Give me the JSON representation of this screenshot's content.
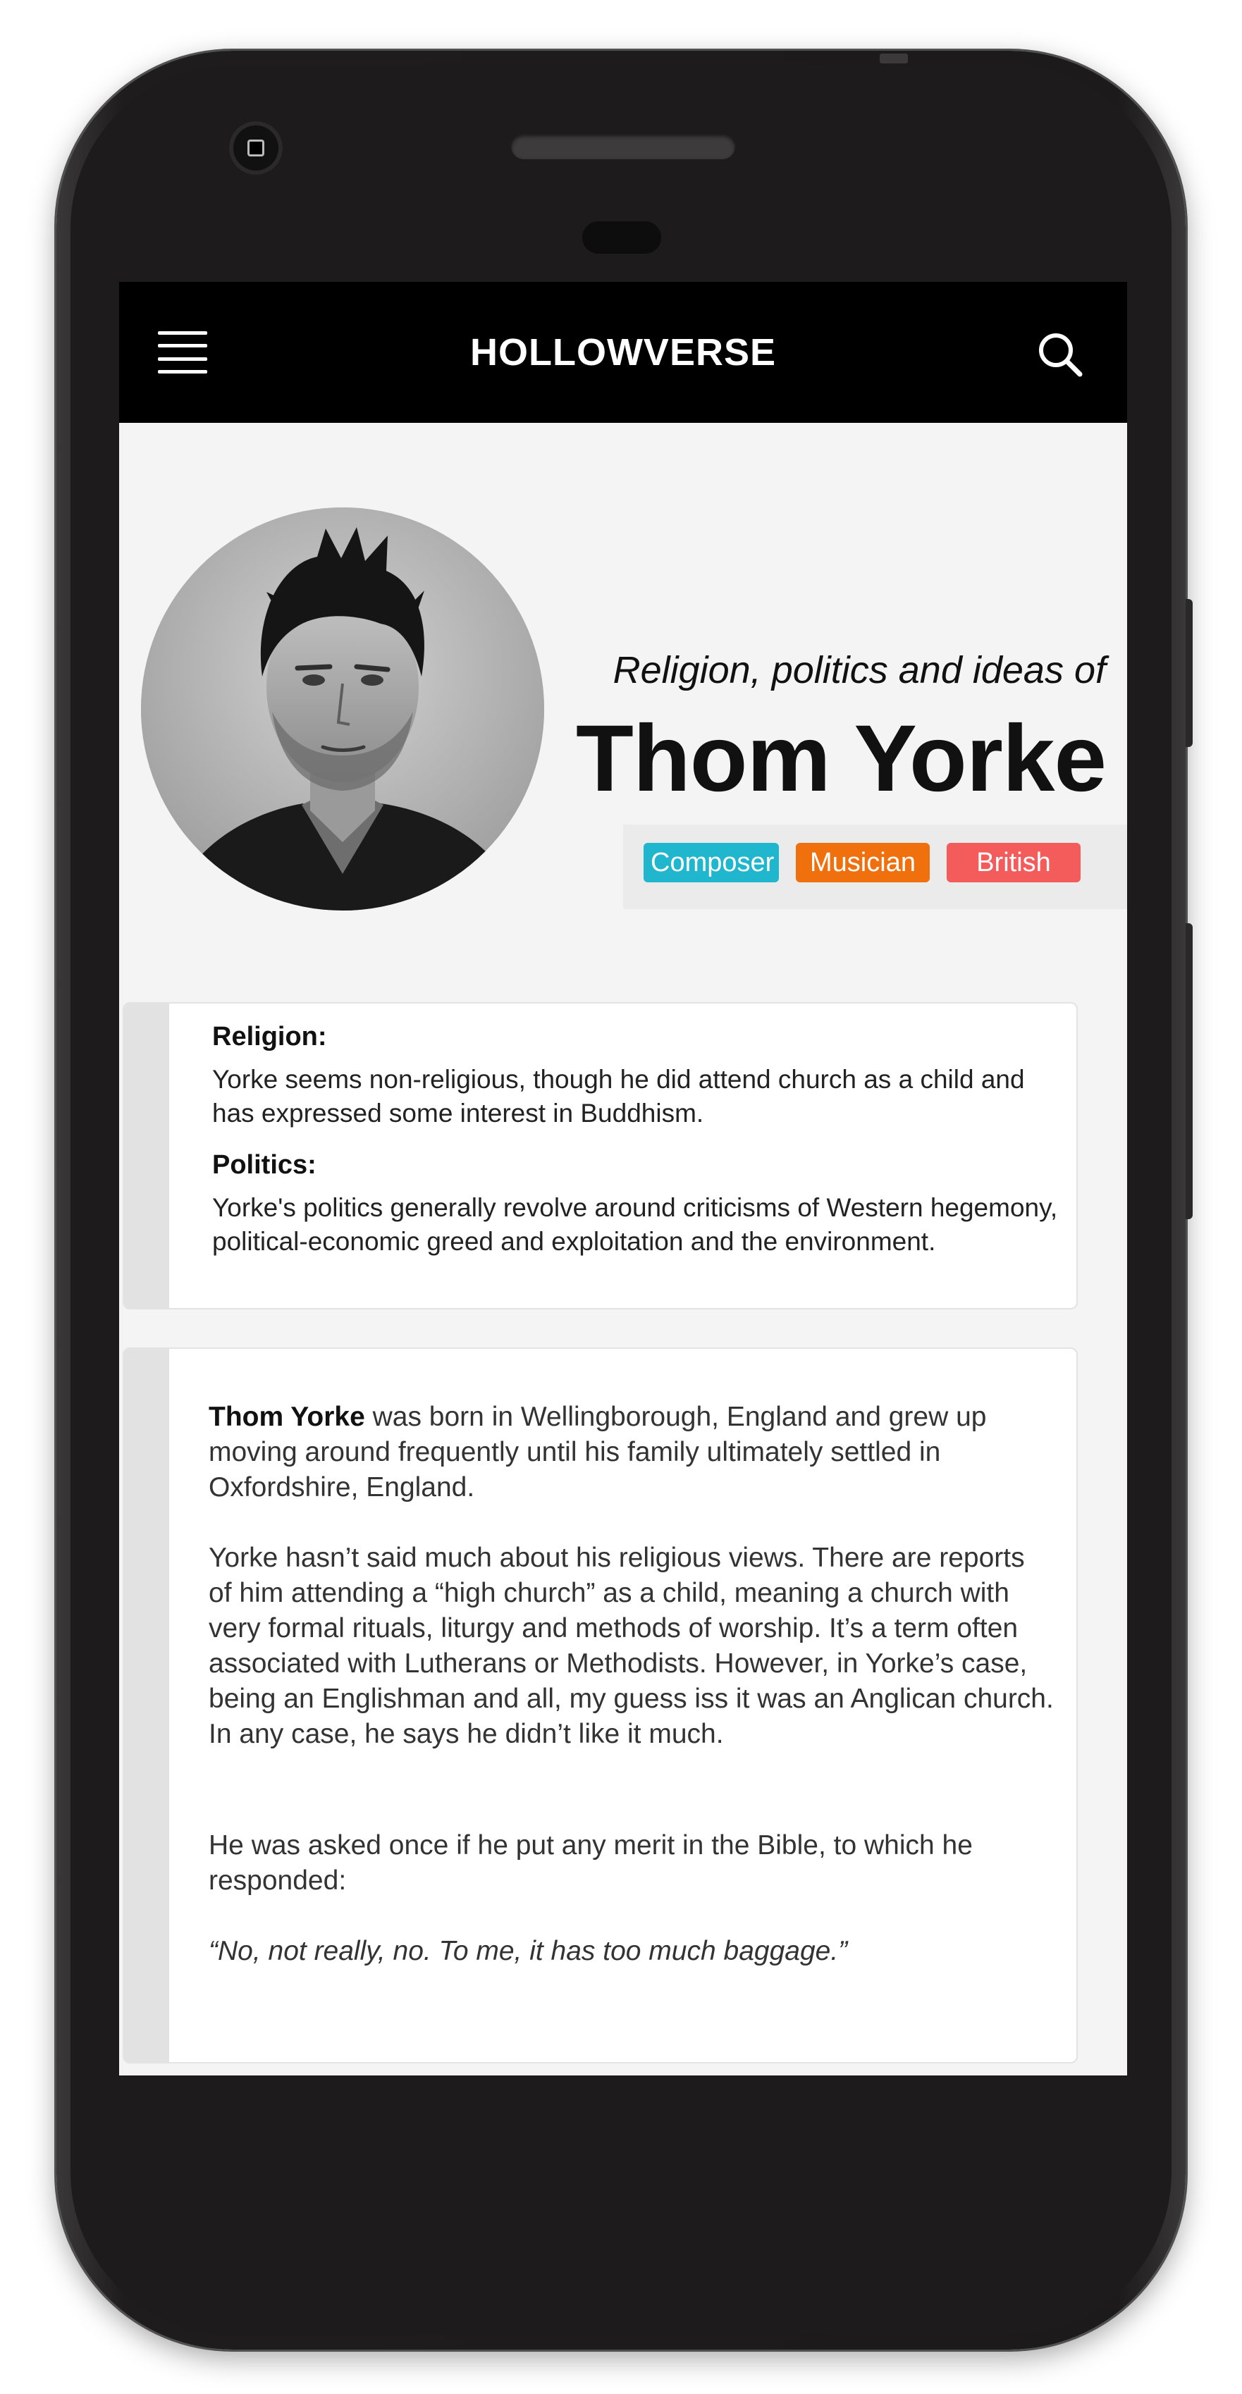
{
  "app": {
    "title": "HOLLOWVERSE"
  },
  "icons": {
    "menu": "hamburger-menu-icon",
    "search": "search-icon",
    "avatar": "portrait-photo"
  },
  "hero": {
    "subtitle": "Religion, politics and ideas of",
    "name": "Thom Yorke",
    "tags": [
      {
        "label": "Composer",
        "color": "#1fb6ce"
      },
      {
        "label": "Musician",
        "color": "#f0700e"
      },
      {
        "label": "British",
        "color": "#f45b5b"
      }
    ]
  },
  "summary": {
    "religion_heading": "Religion:",
    "religion_text": "Yorke seems non-religious, though he did attend church as a child and has expressed some interest in Buddhism.",
    "politics_heading": "Politics:",
    "politics_text": "Yorke's politics generally revolve around criticisms of Western hegemony, political-economic greed and exploitation and the environment."
  },
  "article": {
    "intro_name": "Thom Yorke",
    "intro_rest": " was born in Wellingborough, England and grew up moving around frequently until his family ultimately settled in Oxfordshire, England.",
    "paragraph2": "Yorke hasn’t said much about his religious views. There are reports of him attending a “high church” as a child, meaning a church with very formal rituals, liturgy and methods of worship. It’s a term often associated with Lutherans or Methodists. However, in Yorke’s case, being an Englishman and all, my guess iss it was an Anglican church. In any case, he says he didn’t like it much.",
    "paragraph3": "He was asked once if he put any merit in the Bible, to which he responded:",
    "quote": "“No, not really, no. To me, it has too much baggage.”"
  }
}
